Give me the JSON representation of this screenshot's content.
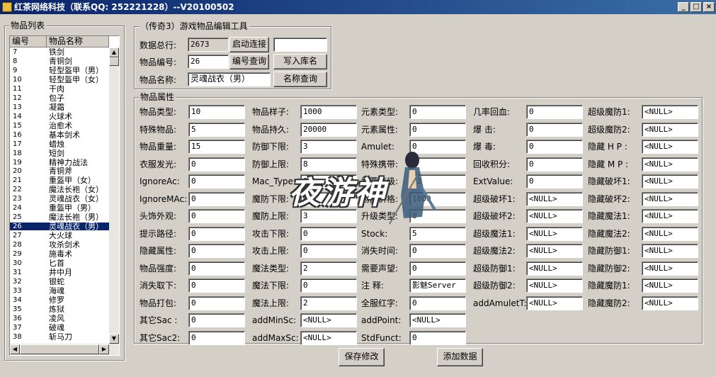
{
  "window": {
    "title": "红茶网络科技（联系QQ: 252221228）--V20100502"
  },
  "item_list": {
    "legend": "物品列表",
    "col_id": "编号",
    "col_name": "物品名称",
    "rows": [
      {
        "id": "7",
        "name": "铁剑"
      },
      {
        "id": "8",
        "name": "青铜剑"
      },
      {
        "id": "9",
        "name": "轻型盔甲（男）"
      },
      {
        "id": "10",
        "name": "轻型盔甲（女）"
      },
      {
        "id": "11",
        "name": "干肉"
      },
      {
        "id": "12",
        "name": "包子"
      },
      {
        "id": "13",
        "name": "凝霜"
      },
      {
        "id": "14",
        "name": "火球术"
      },
      {
        "id": "15",
        "name": "治愈术"
      },
      {
        "id": "16",
        "name": "基本剑术"
      },
      {
        "id": "17",
        "name": "蜡烛"
      },
      {
        "id": "18",
        "name": "短剑"
      },
      {
        "id": "19",
        "name": "精神力战法"
      },
      {
        "id": "20",
        "name": "青铜斧"
      },
      {
        "id": "21",
        "name": "重盔甲（女）"
      },
      {
        "id": "22",
        "name": "魔法长袍（女）"
      },
      {
        "id": "23",
        "name": "灵魂战衣（女）"
      },
      {
        "id": "24",
        "name": "重盔甲（男）"
      },
      {
        "id": "25",
        "name": "魔法长袍（男）"
      },
      {
        "id": "26",
        "name": "灵魂战衣（男）",
        "selected": true
      },
      {
        "id": "27",
        "name": "大火球"
      },
      {
        "id": "28",
        "name": "攻杀剑术"
      },
      {
        "id": "29",
        "name": "施毒术"
      },
      {
        "id": "30",
        "name": "匕首"
      },
      {
        "id": "31",
        "name": "井中月"
      },
      {
        "id": "32",
        "name": "银蛇"
      },
      {
        "id": "33",
        "name": "海魂"
      },
      {
        "id": "34",
        "name": "修罗"
      },
      {
        "id": "35",
        "name": "炼狱"
      },
      {
        "id": "36",
        "name": "凌风"
      },
      {
        "id": "37",
        "name": "破魂"
      },
      {
        "id": "38",
        "name": "斩马刀"
      }
    ]
  },
  "editor": {
    "legend": "（传奇3）游戏物品编辑工具",
    "total_label": "数据总行:",
    "total_value": "2673",
    "connect_button": "启动连接",
    "connect_field": "",
    "id_label": "物品编号:",
    "id_value": "26",
    "query_id_button": "编号查询",
    "write_name_button": "写入库名",
    "name_label": "物品名称:",
    "name_value": "灵魂战衣（男）",
    "query_name_button": "名称查询"
  },
  "attributes": {
    "legend": "物品属性",
    "col1": [
      {
        "label": "物品类型:",
        "value": "10"
      },
      {
        "label": "特殊物品:",
        "value": "5"
      },
      {
        "label": "物品重量:",
        "value": "15"
      },
      {
        "label": "衣服发光:",
        "value": "0"
      },
      {
        "label": "IgnoreAc:",
        "value": "0"
      },
      {
        "label": "IgnoreMAc:",
        "value": "0"
      },
      {
        "label": "头饰外观:",
        "value": "0"
      },
      {
        "label": "提示路径:",
        "value": "0"
      },
      {
        "label": "隐藏属性:",
        "value": "0"
      },
      {
        "label": "物品强度:",
        "value": "0"
      },
      {
        "label": "消失取下:",
        "value": "0"
      },
      {
        "label": "物品打包:",
        "value": "0"
      },
      {
        "label": "其它Sac :",
        "value": "0"
      },
      {
        "label": "其它Sac2:",
        "value": "0"
      }
    ],
    "col2": [
      {
        "label": "物品样子:",
        "value": "1000"
      },
      {
        "label": "物品持久:",
        "value": "20000"
      },
      {
        "label": "防御下限:",
        "value": "3"
      },
      {
        "label": "防御上限:",
        "value": "8"
      },
      {
        "label": "Mac_Type:",
        "value": "0"
      },
      {
        "label": "魔防下限:",
        "value": "0"
      },
      {
        "label": "魔防上限:",
        "value": "3"
      },
      {
        "label": "攻击下限:",
        "value": "0"
      },
      {
        "label": "攻击上限:",
        "value": "0"
      },
      {
        "label": "魔法类型:",
        "value": "2"
      },
      {
        "label": "魔法下限:",
        "value": "0"
      },
      {
        "label": "魔法上限:",
        "value": "2"
      },
      {
        "label": "addMinSc:",
        "value": "<NULL>"
      },
      {
        "label": "addMaxSc:",
        "value": "<NULL>"
      }
    ],
    "col3": [
      {
        "label": "元素类型:",
        "value": "0"
      },
      {
        "label": "元素属性:",
        "value": "0"
      },
      {
        "label": "Amulet:",
        "value": "0"
      },
      {
        "label": "特殊携带:",
        "value": "0"
      },
      {
        "label": "需要等级:",
        "value": "22"
      },
      {
        "label": "物品价格:",
        "value": "1000"
      },
      {
        "label": "升级类型:",
        "value": "0"
      },
      {
        "label": "Stock:",
        "value": "5"
      },
      {
        "label": "消失时间:",
        "value": "0"
      },
      {
        "label": "需要声望:",
        "value": "0"
      },
      {
        "label": "注    释:",
        "value": "影魅Server"
      },
      {
        "label": "全服红字:",
        "value": "0"
      },
      {
        "label": "addPoint:",
        "value": "<NULL>"
      },
      {
        "label": "StdFunct:",
        "value": "0"
      }
    ],
    "col4": [
      {
        "label": "几率回血:",
        "value": "0"
      },
      {
        "label": "爆    击:",
        "value": "0"
      },
      {
        "label": "爆    毒:",
        "value": "0"
      },
      {
        "label": "回收积分:",
        "value": "0"
      },
      {
        "label": "ExtValue:",
        "value": "0"
      },
      {
        "label": "超级破坏1:",
        "value": "<NULL>"
      },
      {
        "label": "超级破坏2:",
        "value": "<NULL>"
      },
      {
        "label": "超级魔法1:",
        "value": "<NULL>"
      },
      {
        "label": "超级魔法2:",
        "value": "<NULL>"
      },
      {
        "label": "超级防御1:",
        "value": "<NULL>"
      },
      {
        "label": "超级防御2:",
        "value": "<NULL>"
      },
      {
        "label": "addAmuletT:",
        "value": "<NULL>"
      }
    ],
    "col5": [
      {
        "label": "超级魔防1:",
        "value": "<NULL>"
      },
      {
        "label": "超级魔防2:",
        "value": "<NULL>"
      },
      {
        "label": "隐藏 H P :",
        "value": "<NULL>"
      },
      {
        "label": "隐藏 M P :",
        "value": "<NULL>"
      },
      {
        "label": "隐藏破坏1:",
        "value": "<NULL>"
      },
      {
        "label": "隐藏破坏2:",
        "value": "<NULL>"
      },
      {
        "label": "隐藏魔法1:",
        "value": "<NULL>"
      },
      {
        "label": "隐藏魔法2:",
        "value": "<NULL>"
      },
      {
        "label": "隐藏防御1:",
        "value": "<NULL>"
      },
      {
        "label": "隐藏防御2:",
        "value": "<NULL>"
      },
      {
        "label": "隐藏魔防1:",
        "value": "<NULL>"
      },
      {
        "label": "隐藏魔防2:",
        "value": "<NULL>"
      }
    ]
  },
  "footer": {
    "save_button": "保存修改",
    "add_button": "添加数据"
  },
  "watermark": {
    "text": "夜游神"
  }
}
